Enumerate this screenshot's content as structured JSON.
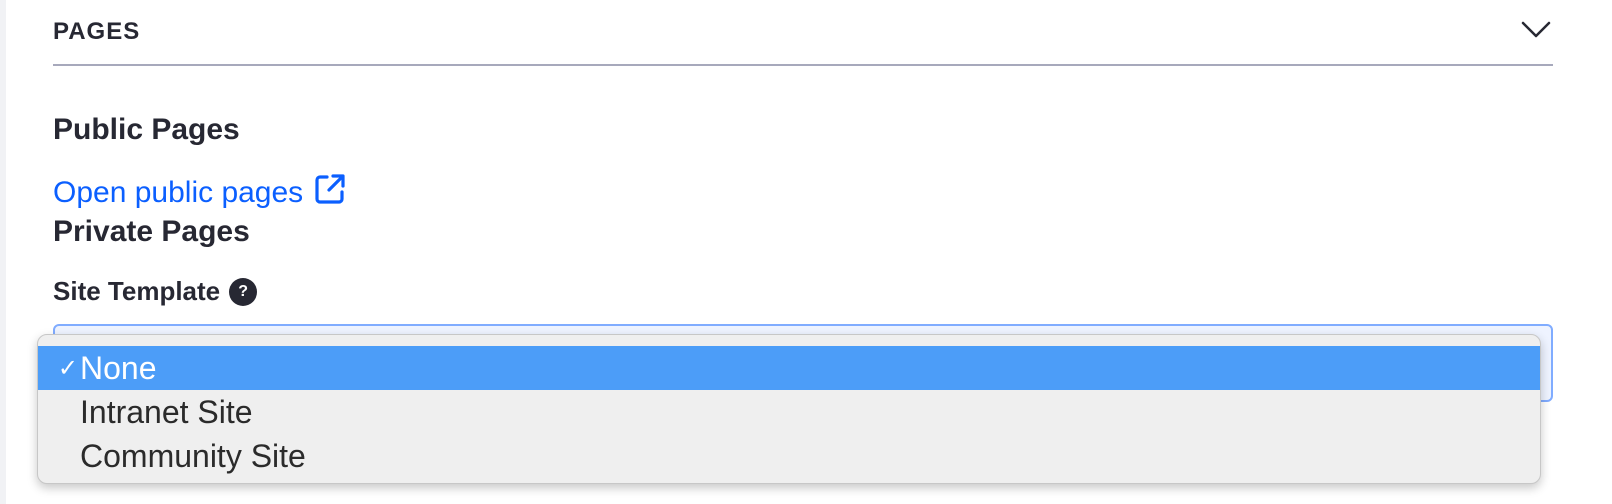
{
  "section": {
    "title": "PAGES",
    "toggle_icon": "chevron-down-icon"
  },
  "public_pages": {
    "heading": "Public Pages",
    "link_text": "Open public pages",
    "link_icon": "external-link-icon"
  },
  "private_pages": {
    "heading": "Private Pages"
  },
  "site_template": {
    "label": "Site Template",
    "help_icon": "help-icon",
    "help_glyph": "?",
    "options": [
      {
        "label": "None",
        "selected": true,
        "check": "✓"
      },
      {
        "label": "Intranet Site",
        "selected": false
      },
      {
        "label": "Community Site",
        "selected": false
      }
    ]
  },
  "colors": {
    "link": "#0b5fff",
    "selected_option_bg": "#4c9df8",
    "select_border": "#80acff"
  }
}
